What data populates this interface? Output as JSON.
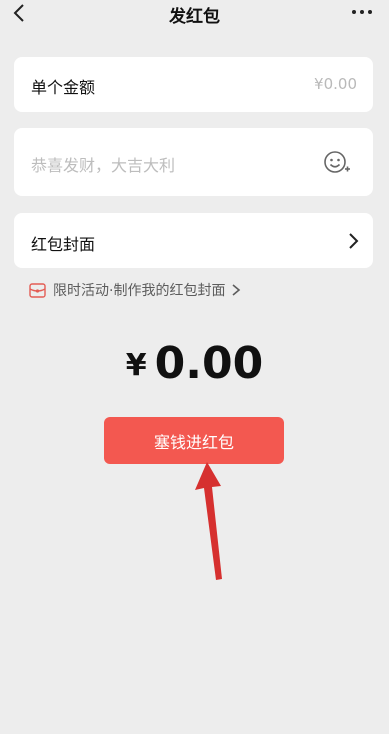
{
  "header": {
    "title": "发红包",
    "back_icon": "chevron-left-icon",
    "more_icon": "more-icon"
  },
  "amount_row": {
    "label": "单个金额",
    "value": "¥0.00"
  },
  "greeting": {
    "placeholder": "恭喜发财，大吉大利",
    "emoji_icon": "emoji-icon"
  },
  "cover_row": {
    "label": "红包封面",
    "chevron_icon": "chevron-right-icon"
  },
  "promo": {
    "text": "限时活动·制作我的红包封面",
    "icon": "red-packet-cover-icon",
    "arrow_icon": "chevron-right-icon"
  },
  "total": {
    "currency": "¥",
    "value": "0.00"
  },
  "send_button": {
    "label": "塞钱进红包"
  },
  "colors": {
    "accent": "#f35850",
    "background": "#ededed",
    "annotation_arrow": "#d6302f"
  }
}
